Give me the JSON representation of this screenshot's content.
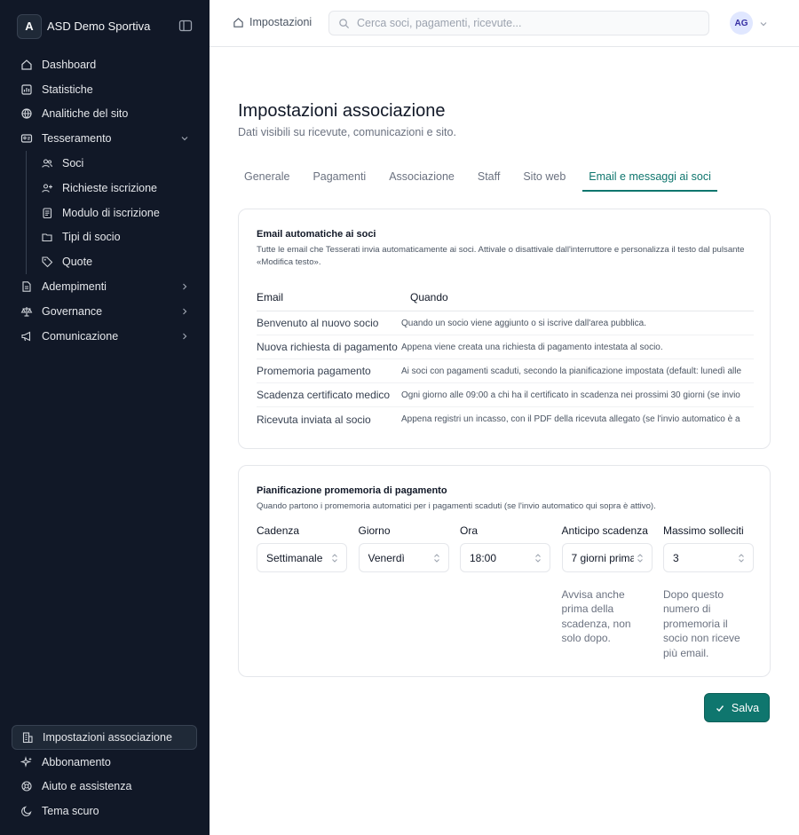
{
  "brand": {
    "initial": "A",
    "name": "ASD Demo Sportiva"
  },
  "sidebar": {
    "items": [
      {
        "label": "Dashboard",
        "icon": "home-icon"
      },
      {
        "label": "Statistiche",
        "icon": "chart-icon"
      },
      {
        "label": "Analitiche del sito",
        "icon": "globe-icon"
      },
      {
        "label": "Tesseramento",
        "icon": "id-card-icon",
        "expanded": true
      }
    ],
    "sub_items": [
      {
        "label": "Soci",
        "icon": "users-icon"
      },
      {
        "label": "Richieste iscrizione",
        "icon": "user-plus-icon"
      },
      {
        "label": "Modulo di iscrizione",
        "icon": "form-icon"
      },
      {
        "label": "Tipi di socio",
        "icon": "folder-icon"
      },
      {
        "label": "Quote",
        "icon": "tag-icon"
      }
    ],
    "more_items": [
      {
        "label": "Adempimenti",
        "icon": "document-icon"
      },
      {
        "label": "Governance",
        "icon": "scale-icon"
      },
      {
        "label": "Comunicazione",
        "icon": "megaphone-icon"
      }
    ],
    "bottom_items": [
      {
        "label": "Impostazioni associazione",
        "icon": "building-icon",
        "active": true
      },
      {
        "label": "Abbonamento",
        "icon": "sparkles-icon"
      },
      {
        "label": "Aiuto e assistenza",
        "icon": "lifebuoy-icon"
      },
      {
        "label": "Tema scuro",
        "icon": "moon-icon"
      }
    ]
  },
  "topbar": {
    "breadcrumb": "Impostazioni",
    "search_placeholder": "Cerca soci, pagamenti, ricevute...",
    "avatar_initials": "AG"
  },
  "page": {
    "title": "Impostazioni associazione",
    "subtitle": "Dati visibili su ricevute, comunicazioni e sito."
  },
  "tabs": [
    {
      "label": "Generale",
      "active": false
    },
    {
      "label": "Pagamenti",
      "active": false
    },
    {
      "label": "Associazione",
      "active": false
    },
    {
      "label": "Staff",
      "active": false
    },
    {
      "label": "Sito web",
      "active": false
    },
    {
      "label": "Email e messaggi ai soci",
      "active": true
    }
  ],
  "emails_card": {
    "title": "Email automatiche ai soci",
    "description": "Tutte le email che Tesserati invia automaticamente ai soci. Attivale o disattivale dall'interruttore e personalizza il testo dal pulsante «Modifica testo».",
    "columns": [
      "Email",
      "Quando"
    ],
    "rows": [
      {
        "email": "Benvenuto al nuovo socio",
        "when": "Quando un socio viene aggiunto o si iscrive dall'area pubblica."
      },
      {
        "email": "Nuova richiesta di pagamento",
        "when": "Appena viene creata una richiesta di pagamento intestata al socio."
      },
      {
        "email": "Promemoria pagamento",
        "when": "Ai soci con pagamenti scaduti, secondo la pianificazione impostata (default: lunedì alle"
      },
      {
        "email": "Scadenza certificato medico",
        "when": "Ogni giorno alle 09:00 a chi ha il certificato in scadenza nei prossimi 30 giorni (se invio"
      },
      {
        "email": "Ricevuta inviata al socio",
        "when": "Appena registri un incasso, con il PDF della ricevuta allegato (se l'invio automatico è a"
      }
    ]
  },
  "schedule_card": {
    "title": "Pianificazione promemoria di pagamento",
    "description": "Quando partono i promemoria automatici per i pagamenti scaduti (se l'invio automatico qui sopra è attivo).",
    "fields": [
      {
        "label": "Cadenza",
        "value": "Settimanale",
        "help": ""
      },
      {
        "label": "Giorno",
        "value": "Venerdì",
        "help": ""
      },
      {
        "label": "Ora",
        "value": "18:00",
        "help": ""
      },
      {
        "label": "Anticipo scadenza",
        "value": "7 giorni prima",
        "help": "Avvisa anche prima della scadenza, non solo dopo."
      },
      {
        "label": "Massimo solleciti",
        "value": "3",
        "help": "Dopo questo numero di promemoria il socio non riceve più email."
      }
    ]
  },
  "save_label": "Salva",
  "colors": {
    "sidebar_bg": "#111827",
    "accent": "#0f766e"
  }
}
